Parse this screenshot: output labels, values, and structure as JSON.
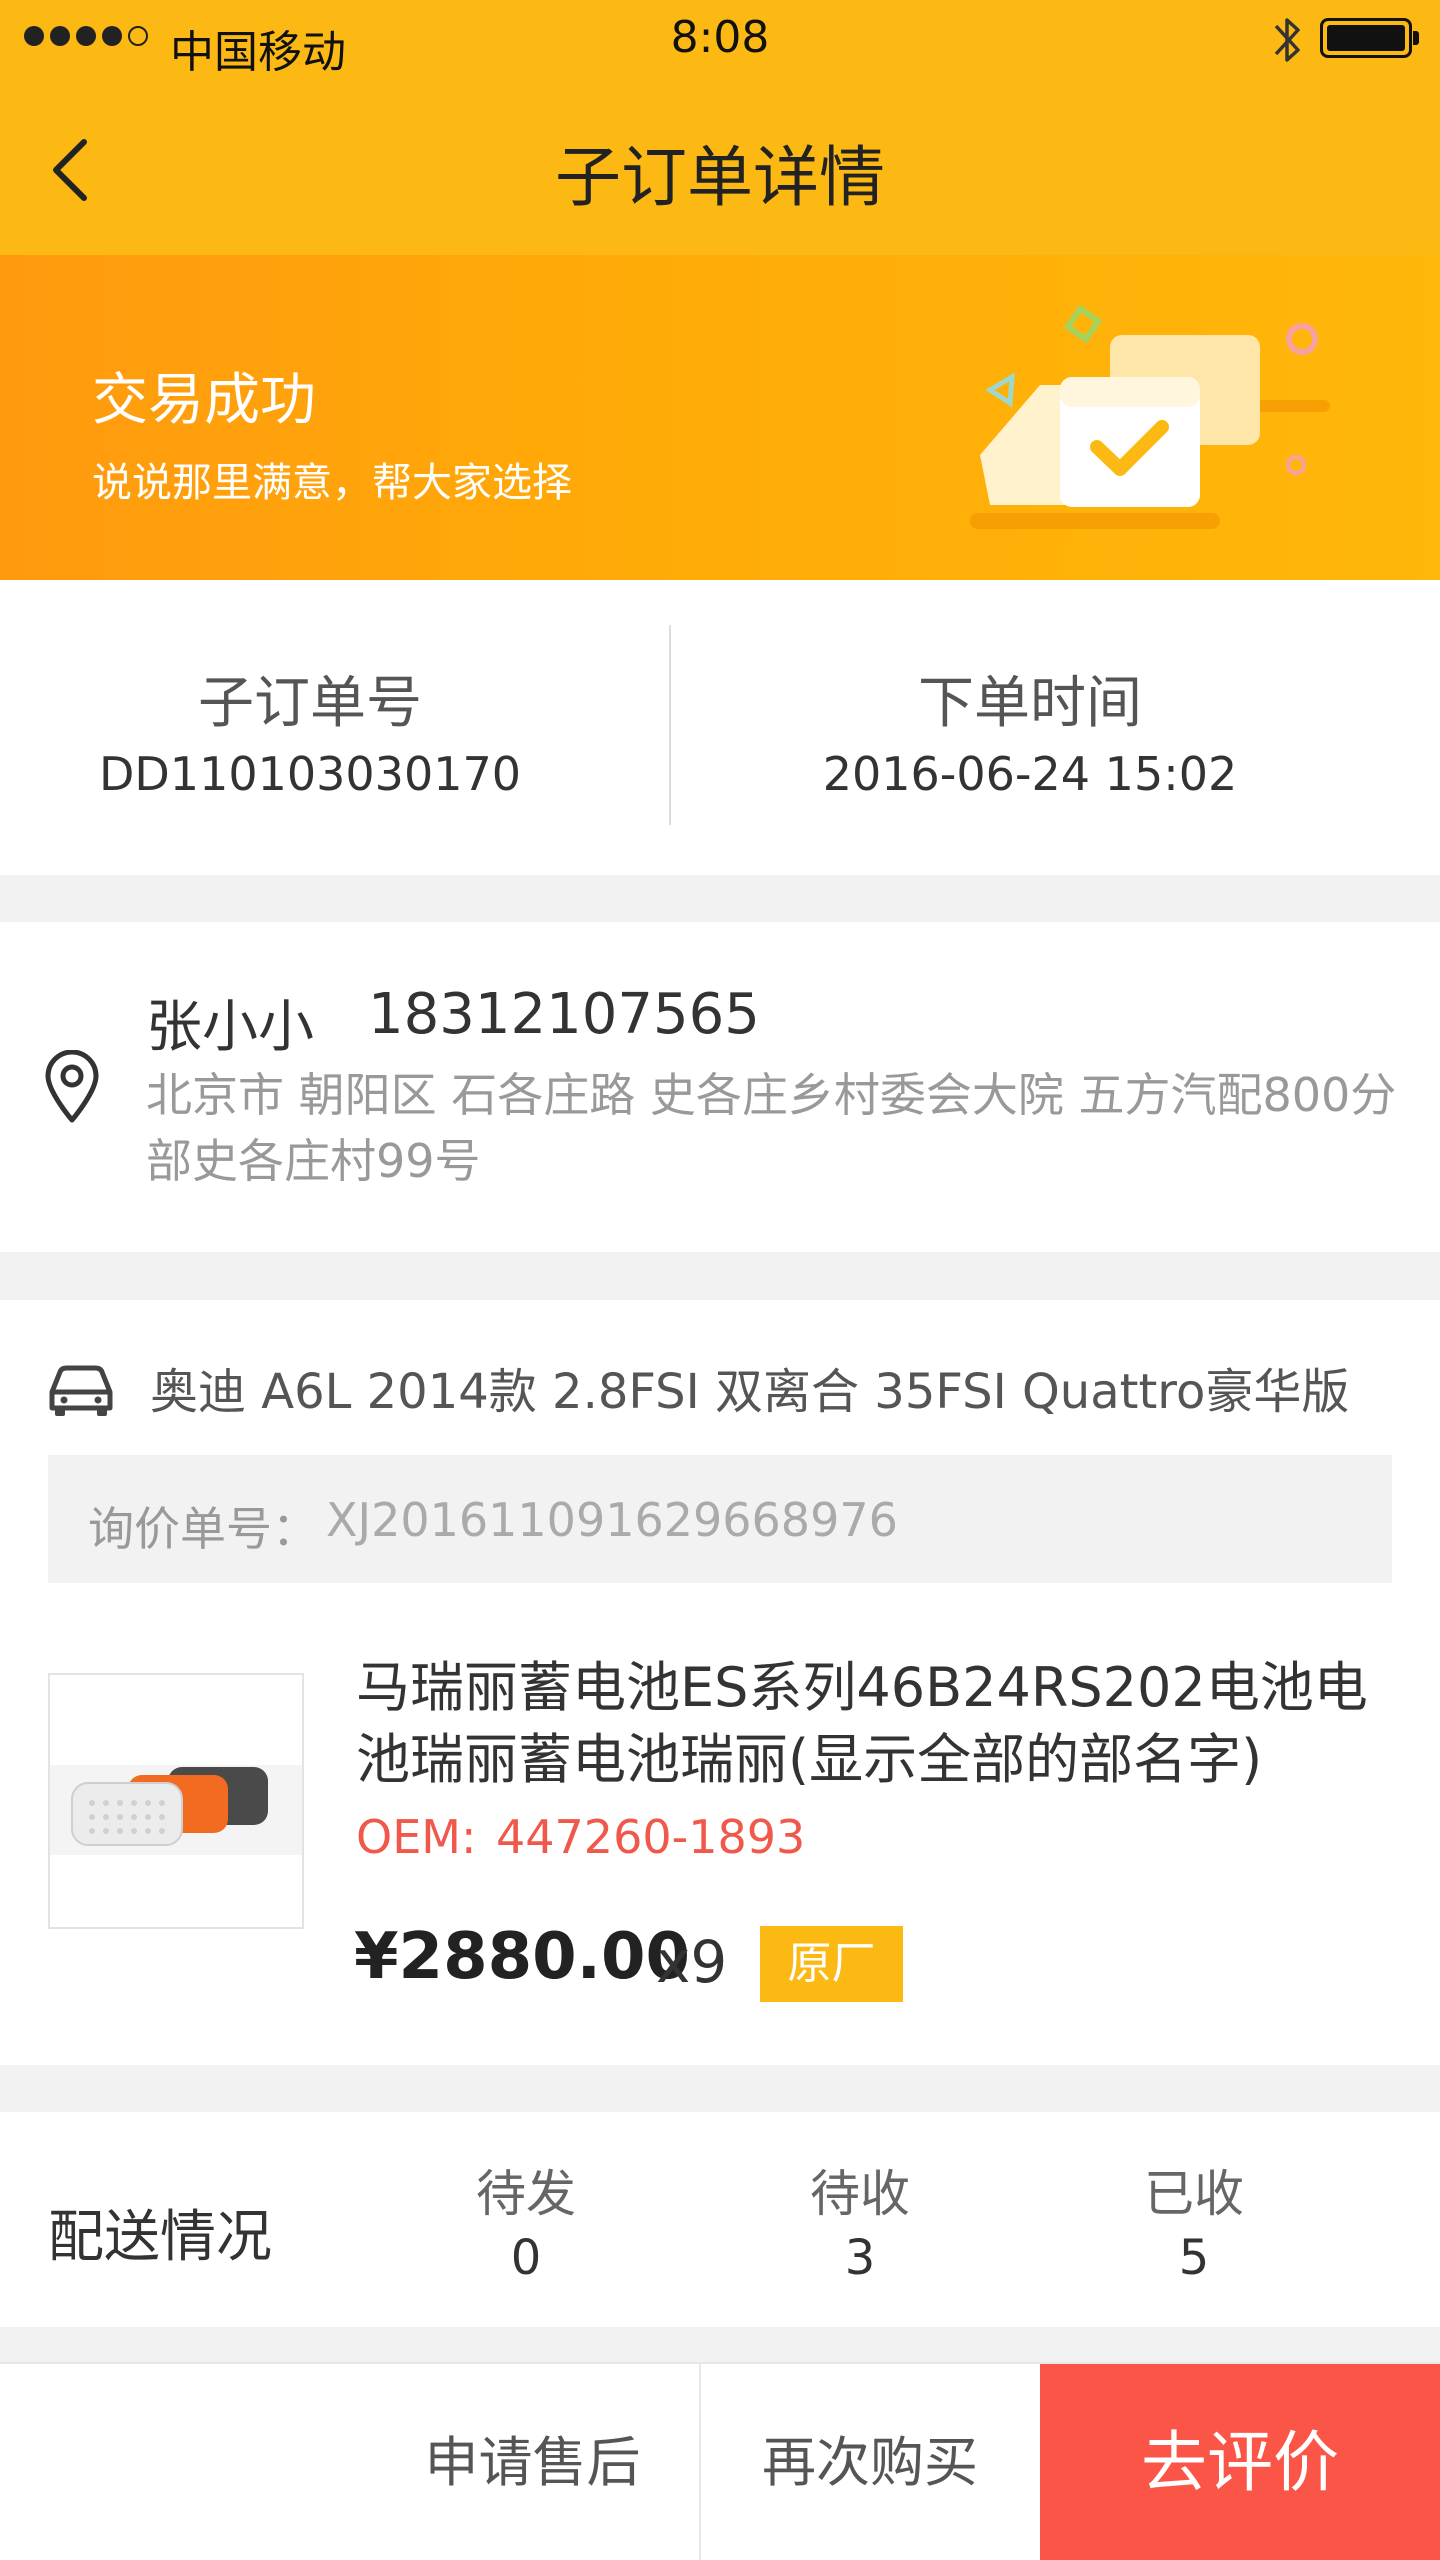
{
  "status_bar": {
    "carrier": "中国移动",
    "time": "8:08"
  },
  "nav": {
    "title": "子订单详情"
  },
  "banner": {
    "title": "交易成功",
    "subtitle": "说说那里满意，帮大家选择"
  },
  "order_info": {
    "order_no_label": "子订单号",
    "order_no": "DD110103030170",
    "order_time_label": "下单时间",
    "order_time": "2016-06-24   15:02"
  },
  "address": {
    "name": "张小小",
    "phone": "18312107565",
    "detail": "北京市 朝阳区 石各庄路 史各庄乡村委会大院 五方汽配800分部史各庄村99号"
  },
  "vehicle": {
    "model": "奥迪 A6L 2014款 2.8FSI 双离合 35FSI Quattro豪华版"
  },
  "inquiry": {
    "label": "询价单号：",
    "value": "XJ2016110916296689​76"
  },
  "product": {
    "name": "马瑞丽蓄电池ES系列46B24RS202电池电池瑞丽蓄电池瑞丽(显示全部的部名字)",
    "oem_label": "OEM:",
    "oem_value": "447260-1893",
    "price": "¥2880.00",
    "quantity": "x9",
    "badge": "原厂"
  },
  "delivery": {
    "title": "配送情况",
    "stats": [
      {
        "label": "待发",
        "value": "0"
      },
      {
        "label": "待收",
        "value": "3"
      },
      {
        "label": "已收",
        "value": "5"
      }
    ]
  },
  "actions": {
    "after_sale": "申请售后",
    "buy_again": "再次购买",
    "review": "去评价"
  },
  "colors": {
    "brand_yellow": "#fdb913",
    "banner_orange": "#ff9a0f",
    "accent_red": "#fb5548",
    "oem_red": "#f0584b"
  }
}
